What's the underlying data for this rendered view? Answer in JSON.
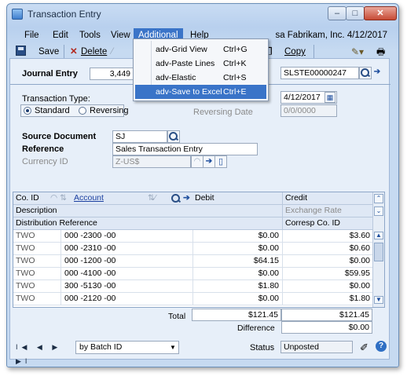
{
  "window": {
    "title": "Transaction Entry"
  },
  "menubar": {
    "items": [
      "File",
      "Edit",
      "Tools",
      "View",
      "Additional",
      "Help"
    ],
    "company": "sa  Fabrikam, Inc. 4/12/2017"
  },
  "toolbar": {
    "save": "Save",
    "delete": "Delete",
    "copy": "Copy"
  },
  "dropdown": {
    "items": [
      {
        "label": "adv-Grid View",
        "shortcut": "Ctrl+G"
      },
      {
        "label": "adv-Paste Lines",
        "shortcut": "Ctrl+K"
      },
      {
        "label": "adv-Elastic",
        "shortcut": "Ctrl+S"
      },
      {
        "label": "adv-Save to Excel",
        "shortcut": "Ctrl+E"
      }
    ]
  },
  "header": {
    "journal_entry_label": "Journal Entry",
    "journal_entry_value": "3,449",
    "batch_value": "SLSTE00000247",
    "transaction_type_label": "Transaction Type:",
    "standard": "Standard",
    "reversing": "Reversing",
    "date_value": "4/12/2017",
    "reversing_date_label": "Reversing Date",
    "reversing_date_value": "0/0/0000",
    "source_document_label": "Source Document",
    "source_document_value": "SJ",
    "reference_label": "Reference",
    "reference_value": "Sales Transaction Entry",
    "currency_label": "Currency ID",
    "currency_value": "Z-US$"
  },
  "grid": {
    "headers": {
      "co_id": "Co. ID",
      "account": "Account",
      "debit": "Debit",
      "credit": "Credit",
      "description": "Description",
      "exchange_rate": "Exchange Rate",
      "distribution_reference": "Distribution Reference",
      "corresp_co_id": "Corresp Co. ID"
    },
    "rows": [
      {
        "co": "TWO",
        "account": "000 -2300 -00",
        "debit": "$0.00",
        "credit": "$3.60"
      },
      {
        "co": "TWO",
        "account": "000 -2310 -00",
        "debit": "$0.00",
        "credit": "$0.60"
      },
      {
        "co": "TWO",
        "account": "000 -1200 -00",
        "debit": "$64.15",
        "credit": "$0.00"
      },
      {
        "co": "TWO",
        "account": "000 -4100 -00",
        "debit": "$0.00",
        "credit": "$59.95"
      },
      {
        "co": "TWO",
        "account": "300 -5130 -00",
        "debit": "$1.80",
        "credit": "$0.00"
      },
      {
        "co": "TWO",
        "account": "000 -2120 -00",
        "debit": "$0.00",
        "credit": "$1.80"
      }
    ]
  },
  "totals": {
    "total_label": "Total",
    "total_debit": "$121.45",
    "total_credit": "$121.45",
    "difference_label": "Difference",
    "difference_value": "$0.00"
  },
  "footer": {
    "nav_glyphs": "I◀ ◀ ▶ ▶I",
    "sort_value": "by Batch ID",
    "status_label": "Status",
    "status_value": "Unposted"
  },
  "colors": {
    "menu_highlight": "#3a74c8",
    "window_frame": "#6b8fb8"
  }
}
